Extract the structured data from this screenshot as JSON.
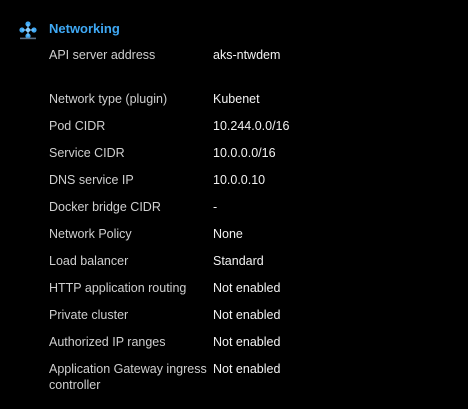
{
  "section": {
    "title": "Networking",
    "icon": "networking-icon",
    "accent_color": "#3fa9f5"
  },
  "rows": [
    {
      "label": "API server address",
      "value": "aks-ntwdem"
    },
    {
      "label": "Network type (plugin)",
      "value": "Kubenet"
    },
    {
      "label": "Pod CIDR",
      "value": "10.244.0.0/16"
    },
    {
      "label": "Service CIDR",
      "value": "10.0.0.0/16"
    },
    {
      "label": "DNS service IP",
      "value": "10.0.0.10"
    },
    {
      "label": "Docker bridge CIDR",
      "value": "-"
    },
    {
      "label": "Network Policy",
      "value": "None"
    },
    {
      "label": "Load balancer",
      "value": "Standard"
    },
    {
      "label": "HTTP application routing",
      "value": "Not enabled"
    },
    {
      "label": "Private cluster",
      "value": "Not enabled"
    },
    {
      "label": "Authorized IP ranges",
      "value": "Not enabled"
    },
    {
      "label": "Application Gateway ingress controller",
      "value": "Not enabled"
    }
  ]
}
